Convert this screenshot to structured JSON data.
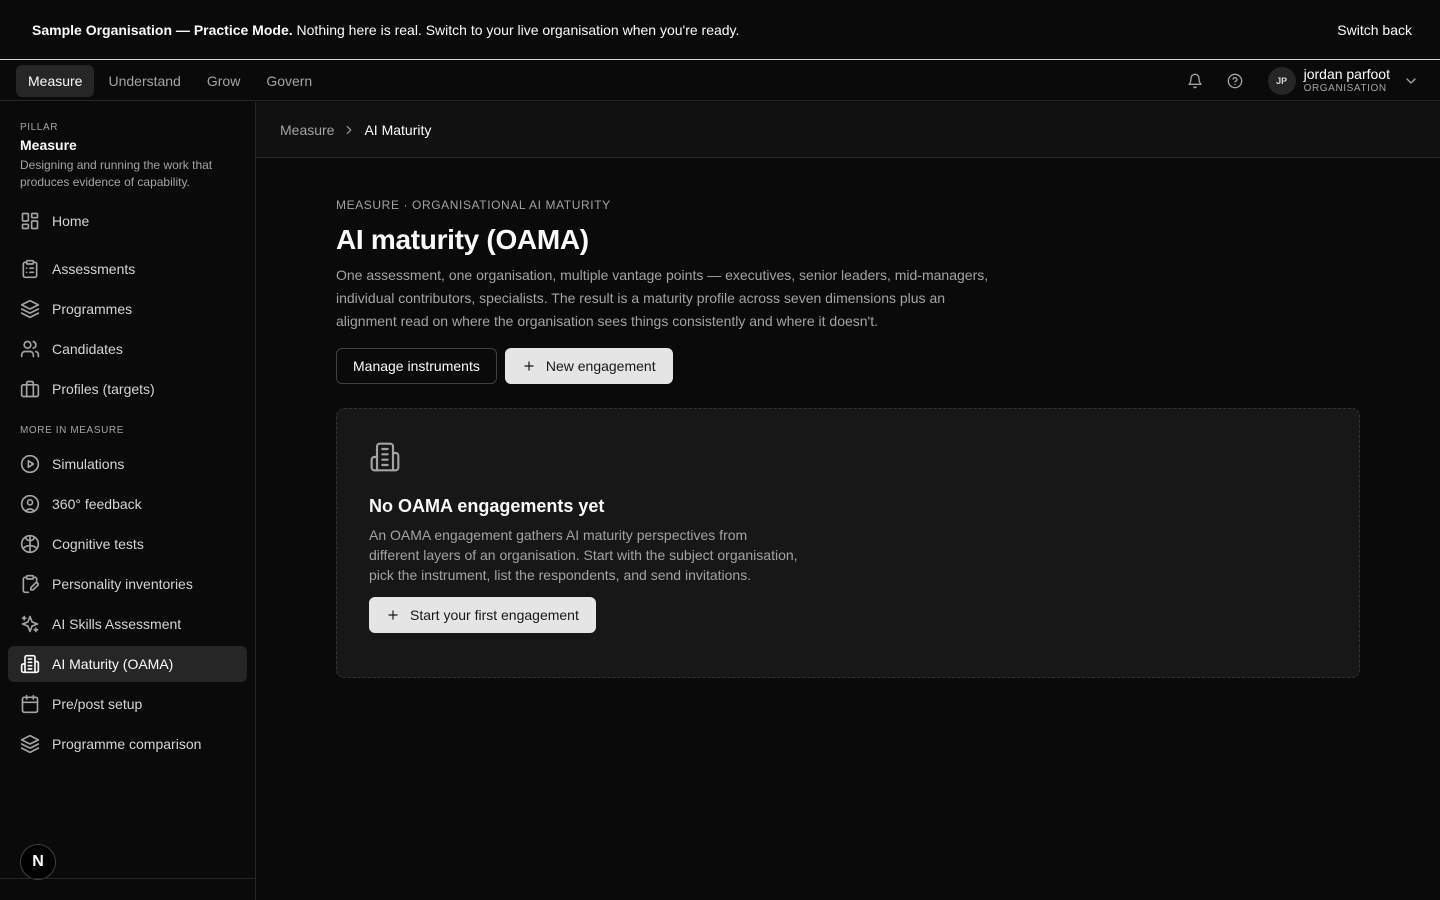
{
  "banner": {
    "bold": "Sample Organisation — Practice Mode.",
    "text": " Nothing here is real. Switch to your live organisation when you're ready.",
    "switch_back": "Switch back"
  },
  "topnav": {
    "tabs": [
      {
        "label": "Measure",
        "active": true
      },
      {
        "label": "Understand",
        "active": false
      },
      {
        "label": "Grow",
        "active": false
      },
      {
        "label": "Govern",
        "active": false
      }
    ],
    "user": {
      "initials": "JP",
      "name": "jordan parfoot",
      "role": "ORGANISATION"
    }
  },
  "sidebar": {
    "pillar_label": "PILLAR",
    "pillar_name": "Measure",
    "pillar_desc": "Designing and running the work that produces evidence of capability.",
    "primary": [
      {
        "label": "Home",
        "icon": "grid-icon"
      },
      {
        "label": "Assessments",
        "icon": "clipboard-icon"
      },
      {
        "label": "Programmes",
        "icon": "layers-icon"
      },
      {
        "label": "Candidates",
        "icon": "users-icon"
      },
      {
        "label": "Profiles (targets)",
        "icon": "briefcase-icon"
      }
    ],
    "section_label": "MORE IN MEASURE",
    "more": [
      {
        "label": "Simulations",
        "icon": "play-circle-icon"
      },
      {
        "label": "360° feedback",
        "icon": "user-circle-icon"
      },
      {
        "label": "Cognitive tests",
        "icon": "brain-icon"
      },
      {
        "label": "Personality inventories",
        "icon": "clipboard-pen-icon"
      },
      {
        "label": "AI Skills Assessment",
        "icon": "sparkles-icon"
      },
      {
        "label": "AI Maturity (OAMA)",
        "icon": "building-icon",
        "active": true
      },
      {
        "label": "Pre/post setup",
        "icon": "calendar-icon"
      },
      {
        "label": "Programme comparison",
        "icon": "layers-icon"
      }
    ],
    "badge": "N"
  },
  "breadcrumb": {
    "parent": "Measure",
    "current": "AI Maturity"
  },
  "page": {
    "eyebrow": "MEASURE · ORGANISATIONAL AI MATURITY",
    "title": "AI maturity (OAMA)",
    "lead": "One assessment, one organisation, multiple vantage points — executives, senior leaders, mid-managers, individual contributors, specialists. The result is a maturity profile across seven dimensions plus an alignment read on where the organisation sees things consistently and where it doesn't.",
    "manage_label": "Manage instruments",
    "new_label": "New engagement"
  },
  "empty": {
    "title": "No OAMA engagements yet",
    "desc": "An OAMA engagement gathers AI maturity perspectives from different layers of an organisation. Start with the subject organisation, pick the instrument, list the respondents, and send invitations.",
    "cta": "Start your first engagement"
  }
}
